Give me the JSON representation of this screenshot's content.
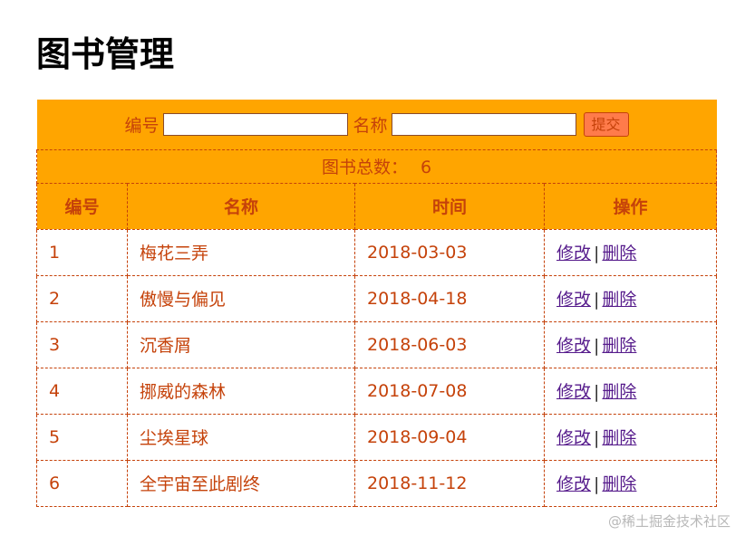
{
  "page": {
    "title": "图书管理"
  },
  "form": {
    "id_label": "编号",
    "id_value": "",
    "name_label": "名称",
    "name_value": "",
    "submit_label": "提交"
  },
  "summary": {
    "label": "图书总数：",
    "count": "6"
  },
  "table": {
    "headers": [
      "编号",
      "名称",
      "时间",
      "操作"
    ],
    "rows": [
      {
        "id": "1",
        "name": "梅花三弄",
        "date": "2018-03-03"
      },
      {
        "id": "2",
        "name": "傲慢与偏见",
        "date": "2018-04-18"
      },
      {
        "id": "3",
        "name": "沉香屑",
        "date": "2018-06-03"
      },
      {
        "id": "4",
        "name": "挪威的森林",
        "date": "2018-07-08"
      },
      {
        "id": "5",
        "name": "尘埃星球",
        "date": "2018-09-04"
      },
      {
        "id": "6",
        "name": "全宇宙至此剧终",
        "date": "2018-11-12"
      }
    ],
    "edit_label": "修改",
    "separator": "|",
    "delete_label": "删除"
  },
  "watermark": "@稀土掘金技术社区",
  "colors": {
    "accent": "#ffa500",
    "text": "#c5420a",
    "link": "#551a8b",
    "button": "#ff7b4a"
  }
}
